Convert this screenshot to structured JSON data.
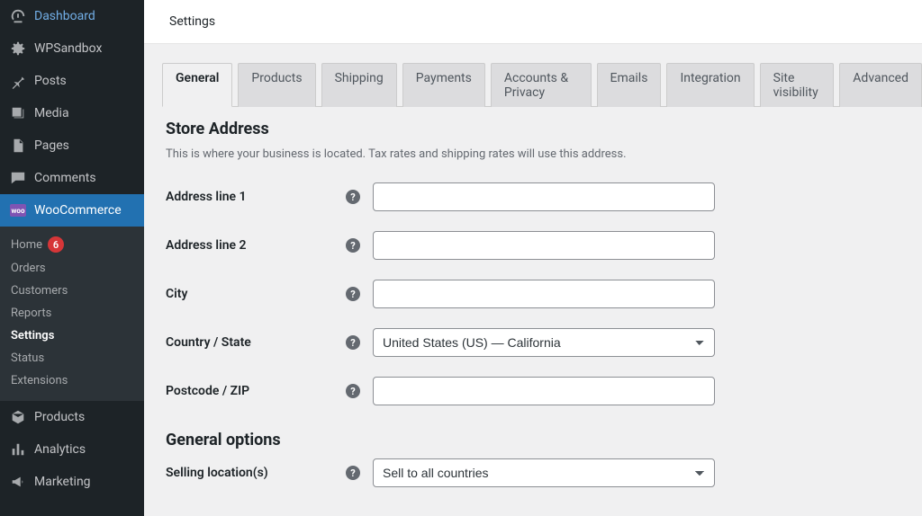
{
  "sidebar": {
    "top": [
      {
        "id": "dashboard",
        "label": "Dashboard",
        "icon": "dashboard-icon"
      },
      {
        "id": "wpsandbox",
        "label": "WPSandbox",
        "icon": "gear-icon"
      }
    ],
    "content": [
      {
        "id": "posts",
        "label": "Posts",
        "icon": "pin-icon"
      },
      {
        "id": "media",
        "label": "Media",
        "icon": "media-icon"
      },
      {
        "id": "pages",
        "label": "Pages",
        "icon": "pages-icon"
      },
      {
        "id": "comments",
        "label": "Comments",
        "icon": "comment-icon"
      }
    ],
    "woocommerce": {
      "label": "WooCommerce"
    },
    "submenu": [
      {
        "id": "home",
        "label": "Home",
        "badge": "6"
      },
      {
        "id": "orders",
        "label": "Orders"
      },
      {
        "id": "customers",
        "label": "Customers"
      },
      {
        "id": "reports",
        "label": "Reports"
      },
      {
        "id": "settings",
        "label": "Settings",
        "active": true
      },
      {
        "id": "status",
        "label": "Status"
      },
      {
        "id": "extensions",
        "label": "Extensions"
      }
    ],
    "bottom": [
      {
        "id": "products",
        "label": "Products",
        "icon": "box-icon"
      },
      {
        "id": "analytics",
        "label": "Analytics",
        "icon": "analytics-icon"
      },
      {
        "id": "marketing",
        "label": "Marketing",
        "icon": "megaphone-icon"
      }
    ]
  },
  "header": {
    "title": "Settings"
  },
  "tabs": [
    {
      "id": "general",
      "label": "General",
      "active": true
    },
    {
      "id": "products",
      "label": "Products"
    },
    {
      "id": "shipping",
      "label": "Shipping"
    },
    {
      "id": "payments",
      "label": "Payments"
    },
    {
      "id": "accounts",
      "label": "Accounts & Privacy"
    },
    {
      "id": "emails",
      "label": "Emails"
    },
    {
      "id": "integration",
      "label": "Integration"
    },
    {
      "id": "visibility",
      "label": "Site visibility"
    },
    {
      "id": "advanced",
      "label": "Advanced"
    }
  ],
  "store_address": {
    "heading": "Store Address",
    "description": "This is where your business is located. Tax rates and shipping rates will use this address.",
    "fields": {
      "address1": {
        "label": "Address line 1",
        "value": ""
      },
      "address2": {
        "label": "Address line 2",
        "value": ""
      },
      "city": {
        "label": "City",
        "value": ""
      },
      "country": {
        "label": "Country / State",
        "value": "United States (US) — California"
      },
      "postcode": {
        "label": "Postcode / ZIP",
        "value": ""
      }
    }
  },
  "general_options": {
    "heading": "General options",
    "selling_location": {
      "label": "Selling location(s)",
      "value": "Sell to all countries"
    }
  },
  "help_tooltip": "?"
}
